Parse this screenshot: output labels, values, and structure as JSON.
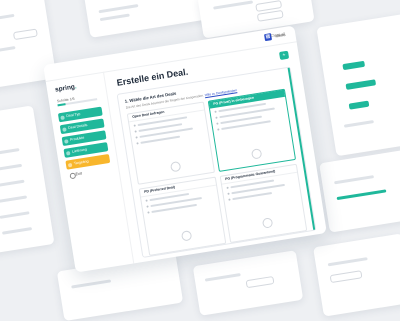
{
  "topbar": {
    "menu_icon": "grid-icon",
    "menu_label": "Menu"
  },
  "sidebar": {
    "logo_text": "spring",
    "progress_label": "Schritte 1/6",
    "progress_fraction": 0.2,
    "steps": [
      {
        "label": "Deal Typ"
      },
      {
        "label": "Deal Details"
      },
      {
        "label": "Produkte"
      },
      {
        "label": "Lieferung"
      },
      {
        "label": "Targeting"
      }
    ],
    "exit_label": "Exit"
  },
  "main": {
    "title": "Erstelle ein Deal.",
    "close_label": "Close all",
    "next_icon": "plus-icon",
    "section_title": "1. Wähle die Art des Deals",
    "section_sub": "Die Art des Deals bestimmt die Regeln der Kooperation.",
    "section_link": "Hilfe zu Dealtypologien",
    "options": [
      {
        "label": "Open Deal Anfragen"
      },
      {
        "label": "PG (Privat) in einbezogen"
      },
      {
        "label": "PD (Preferred Deal)"
      },
      {
        "label": "PG (Programmatic Guaranteed)"
      }
    ]
  },
  "colors": {
    "accent": "#1fb89b",
    "highlight": "#f8b62c",
    "brand_blue": "#2a4cc7"
  }
}
